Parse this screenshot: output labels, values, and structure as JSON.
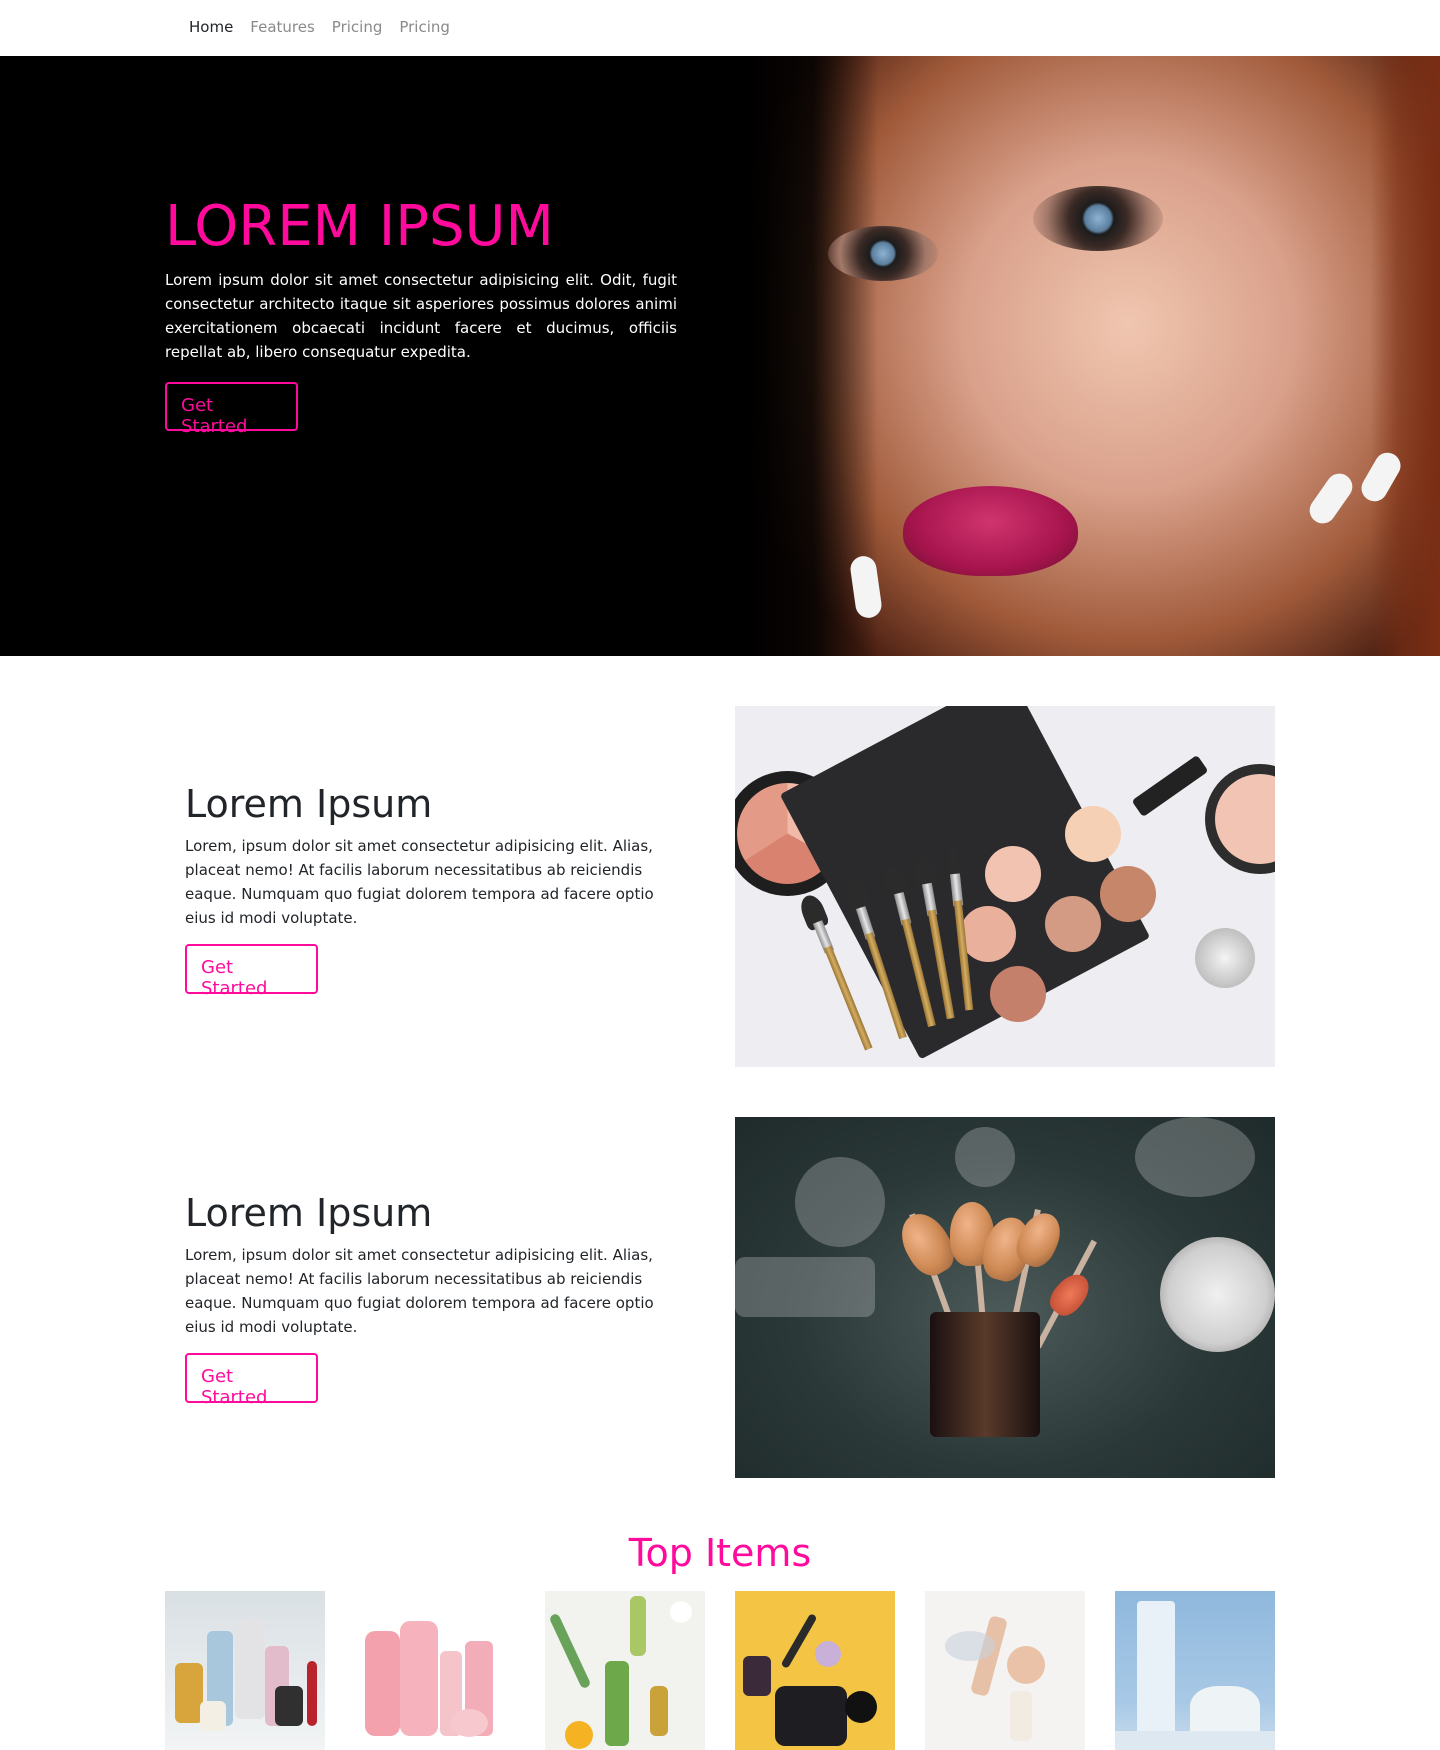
{
  "nav": {
    "links": [
      {
        "label": "Home",
        "active": true
      },
      {
        "label": "Features",
        "active": false
      },
      {
        "label": "Pricing",
        "active": false
      },
      {
        "label": "Pricing",
        "active": false
      }
    ]
  },
  "hero": {
    "title": "LOREM IPSUM",
    "text": "Lorem ipsum dolor sit amet consectetur adipisicing elit. Odit, fugit consectetur architecto itaque sit asperiores possimus dolores animi exercitationem obcaecati incidunt facere et ducimus, officiis repellat ab, libero consequatur expedita.",
    "button": "Get Started"
  },
  "features": [
    {
      "title": "Lorem Ipsum",
      "text": "Lorem, ipsum dolor sit amet consectetur adipisicing elit. Alias, placeat nemo! At facilis laborum necessitatibus ab reiciendis eaque. Numquam quo fugiat dolorem tempora ad facere optio eius id modi voluptate.",
      "button": "Get Started"
    },
    {
      "title": "Lorem Ipsum",
      "text": "Lorem, ipsum dolor sit amet consectetur adipisicing elit. Alias, placeat nemo! At facilis laborum necessitatibus ab reiciendis eaque. Numquam quo fugiat dolorem tempora ad facere optio eius id modi voluptate.",
      "button": "Get Started"
    }
  ],
  "top_items": {
    "title": "Top Items"
  },
  "colors": {
    "accent": "#ff0a9c",
    "hero_bg": "#000000",
    "text": "#212529",
    "nav_inactive": "#8a8a8a"
  }
}
